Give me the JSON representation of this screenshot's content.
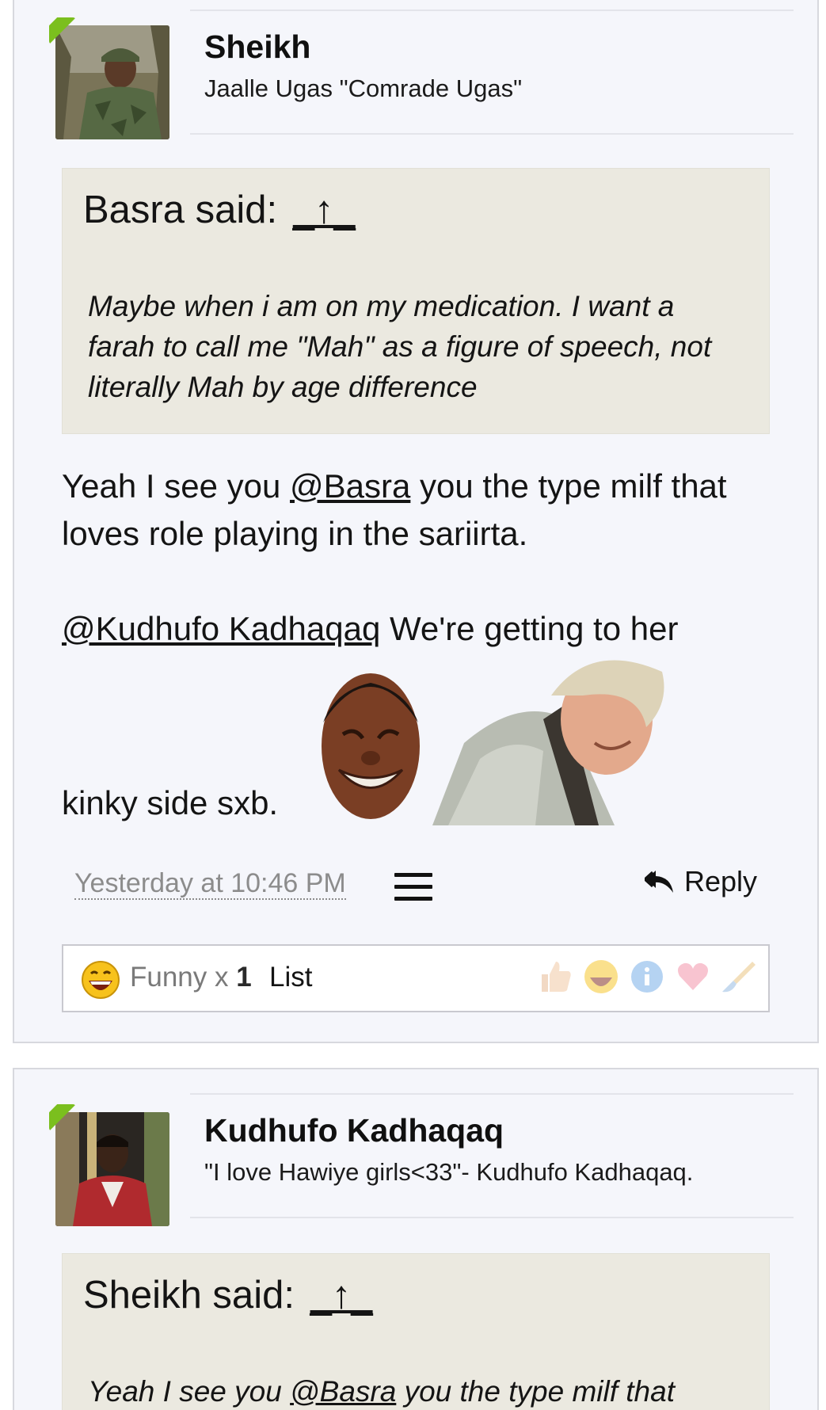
{
  "post1": {
    "username": "Sheikh",
    "user_title": "Jaalle Ugas \"Comrade Ugas\"",
    "quote": {
      "author_label": "Basra said:",
      "arrow": "_↑_",
      "text": "Maybe when i am on my medication. I want a farah to call me \"Mah\" as a figure of speech, not literally Mah by age difference"
    },
    "message": {
      "p1_before": "Yeah I see you ",
      "p1_mention": "@Basra",
      "p1_after": " you the type milf that loves role playing in the sariirta.",
      "p2_mention": "@Kudhufo Kadhaqaq",
      "p2_after": " We're getting to her",
      "p3": "kinky side sxb."
    },
    "timestamp": "Yesterday at 10:46 PM",
    "reply_label": "Reply",
    "reactions": {
      "label": "Funny x ",
      "count": "1",
      "list_label": "List"
    }
  },
  "post2": {
    "username": "Kudhufo Kadhaqaq",
    "user_title": "\"I love Hawiye girls<33\"- Kudhufo Kadhaqaq.",
    "quote": {
      "author_label": "Sheikh said:",
      "arrow": "_↑_",
      "text_before": "Yeah I see you ",
      "text_mention": "@Basra",
      "text_after": " you the type milf that"
    }
  },
  "colors": {
    "page_bg": "#f5f6fb",
    "quote_bg": "#ebe9e0",
    "online_flag": "#7bbf1e",
    "timestamp": "#8c8c8c"
  },
  "icons": [
    "menu-icon",
    "reply-icon",
    "funny-emoji-icon",
    "like-icon",
    "info-icon",
    "love-icon",
    "brush-icon"
  ]
}
